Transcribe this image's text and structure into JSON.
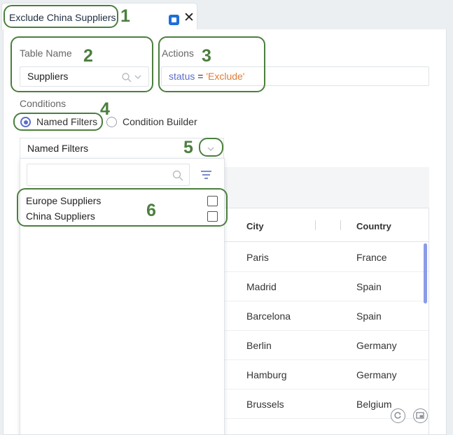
{
  "tab": {
    "title": "Exclude China Suppliers",
    "pin_icon": "pin-icon",
    "close_symbol": "✕"
  },
  "table_name": {
    "label": "Table Name",
    "value": "Suppliers"
  },
  "actions": {
    "label": "Actions",
    "expression": {
      "field": "status",
      "operator": " = ",
      "value": "'Exclude'"
    },
    "colors": {
      "field": "#5c6ec7",
      "value": "#e07b39"
    }
  },
  "conditions": {
    "label": "Conditions",
    "options": [
      {
        "label": "Named Filters",
        "selected": true
      },
      {
        "label": "Condition Builder",
        "selected": false
      }
    ]
  },
  "named_filters": {
    "selected_label": "Named Filters",
    "search_placeholder": "",
    "options": [
      {
        "label": "Europe Suppliers",
        "checked": false
      },
      {
        "label": "China Suppliers",
        "checked": false
      }
    ]
  },
  "grid": {
    "columns": [
      "City",
      "Country"
    ],
    "rows": [
      {
        "city": "Paris",
        "country": "France"
      },
      {
        "city": "Madrid",
        "country": "Spain"
      },
      {
        "city": "Barcelona",
        "country": "Spain"
      },
      {
        "city": "Berlin",
        "country": "Germany"
      },
      {
        "city": "Hamburg",
        "country": "Germany"
      },
      {
        "city": "Brussels",
        "country": "Belgium"
      }
    ]
  },
  "annotations": [
    "1",
    "2",
    "3",
    "4",
    "5",
    "6"
  ],
  "colors": {
    "annotation": "#4b7f3e",
    "accent": "#5c6ec7",
    "pin": "#1e6fd9"
  }
}
